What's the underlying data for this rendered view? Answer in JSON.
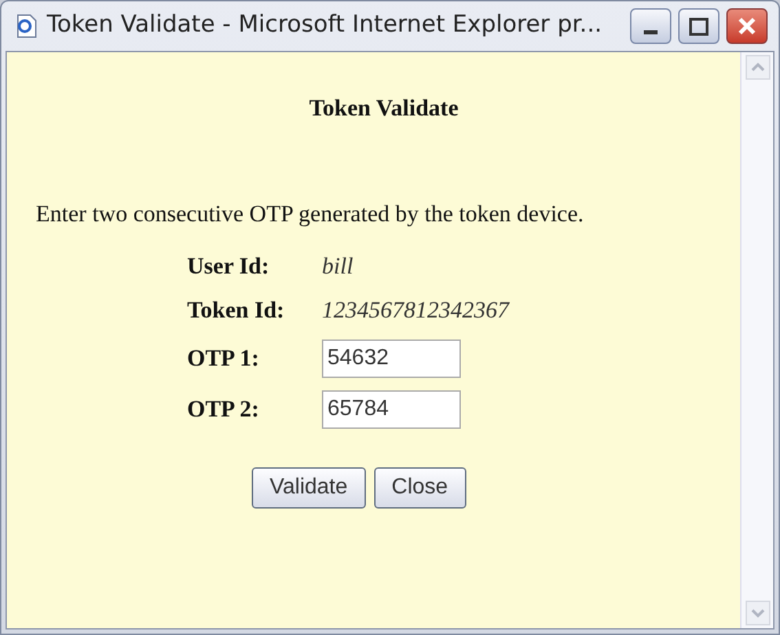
{
  "window": {
    "title": "Token Validate - Microsoft Internet Explorer pr..."
  },
  "page": {
    "heading": "Token Validate",
    "instruction": "Enter two consecutive OTP generated by the token device.",
    "info": [
      {
        "label": "User Id:",
        "value": "bill"
      },
      {
        "label": "Token Id:",
        "value": "1234567812342367"
      }
    ],
    "fields": [
      {
        "label": "OTP 1:",
        "value": "54632"
      },
      {
        "label": "OTP 2:",
        "value": "65784"
      }
    ],
    "buttons": [
      "Validate",
      "Close"
    ]
  }
}
